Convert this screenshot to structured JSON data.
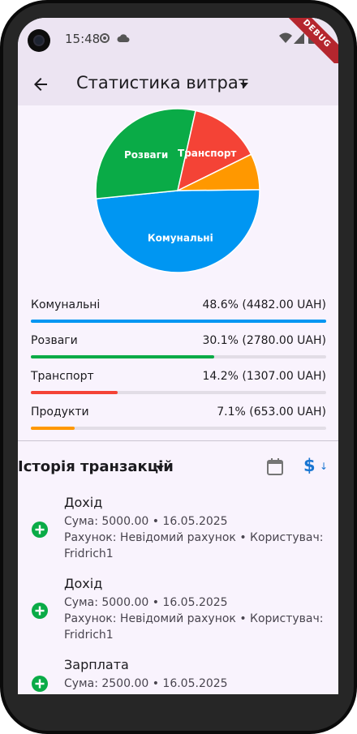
{
  "status_bar": {
    "time": "15:48",
    "debug_banner": "DEBUG"
  },
  "app_bar": {
    "title": "Статистика витрат"
  },
  "colors": {
    "blue": "#0096f2",
    "green": "#0aab47",
    "red": "#f44336",
    "orange": "#ff9800",
    "accent": "#1976d2"
  },
  "chart_data": {
    "type": "pie",
    "slices": [
      {
        "label": "Комунальні",
        "value": 48.6,
        "color": "#0096f2"
      },
      {
        "label": "Розваги",
        "value": 30.1,
        "color": "#0aab47"
      },
      {
        "label": "Транспорт",
        "value": 14.2,
        "color": "#f44336"
      },
      {
        "label": "Продукти",
        "value": 7.1,
        "color": "#ff9800"
      }
    ]
  },
  "stats": [
    {
      "name": "Комунальні",
      "value": "48.6% (4482.00 UAH)",
      "percent": 100,
      "color": "#0096f2"
    },
    {
      "name": "Розваги",
      "value": "30.1% (2780.00 UAH)",
      "percent": 62,
      "color": "#0aab47"
    },
    {
      "name": "Транспорт",
      "value": "14.2% (1307.00 UAH)",
      "percent": 29.4,
      "color": "#f44336"
    },
    {
      "name": "Продукти",
      "value": "7.1% (653.00 UAH)",
      "percent": 14.7,
      "color": "#ff9800"
    }
  ],
  "history": {
    "title": "Історія транзакцій",
    "icons": {
      "calendar": "calendar-icon",
      "currency": "dollar-sort-icon"
    },
    "transactions": [
      {
        "title": "Дохід",
        "line1": "Сума: 5000.00 • 16.05.2025",
        "line2": "Рахунок: Невідомий рахунок • Користувач:",
        "line3": "Fridrich1"
      },
      {
        "title": "Дохід",
        "line1": "Сума: 5000.00 • 16.05.2025",
        "line2": "Рахунок: Невідомий рахунок • Користувач:",
        "line3": "Fridrich1"
      },
      {
        "title": "Зарплата",
        "line1": "Сума: 2500.00 • 16.05.2025",
        "line2": "",
        "line3": ""
      }
    ]
  }
}
